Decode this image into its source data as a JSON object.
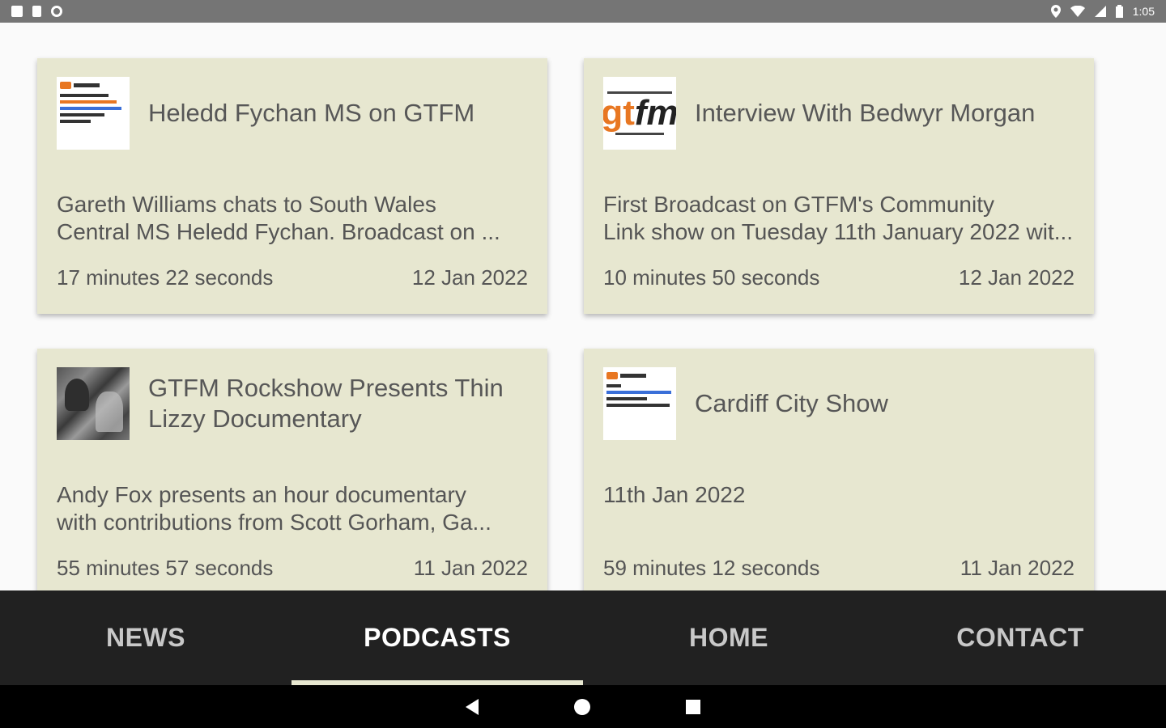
{
  "status_bar": {
    "time": "1:05",
    "left_icons": [
      "notification-square-icon",
      "sd-card-icon",
      "sync-circle-icon"
    ],
    "right_icons": [
      "location-icon",
      "wifi-icon",
      "cell-signal-icon",
      "battery-icon"
    ]
  },
  "podcasts": [
    {
      "title": "Heledd Fychan MS on GTFM",
      "description_line1": "Gareth Williams chats to South Wales",
      "description_line2": "Central MS Heledd Fychan. Broadcast on ...",
      "duration": "17 minutes 22 seconds",
      "date": "12 Jan 2022",
      "thumbnail": "podcast-text-thumbnail"
    },
    {
      "title": "Interview With Bedwyr Morgan",
      "description_line1": "First Broadcast on GTFM's Community",
      "description_line2": "Link show on Tuesday 11th January 2022 wit...",
      "duration": "10 minutes 50 seconds",
      "date": "12 Jan 2022",
      "thumbnail": "gtfm-logo-thumbnail",
      "logo_text_g": "gt",
      "logo_text_fm": "fm"
    },
    {
      "title": "GTFM Rockshow Presents Thin Lizzy Documentary",
      "description_line1": "Andy Fox presents an hour documentary",
      "description_line2": "with contributions from Scott Gorham, Ga...",
      "duration": "55 minutes 57 seconds",
      "date": "11 Jan 2022",
      "thumbnail": "band-photo-thumbnail"
    },
    {
      "title": "Cardiff City Show",
      "description_line1": "11th Jan 2022",
      "description_line2": "",
      "duration": "59 minutes 12 seconds",
      "date": "11 Jan 2022",
      "thumbnail": "podcast-text-thumbnail"
    }
  ],
  "tabs": [
    {
      "label": "NEWS",
      "active": false
    },
    {
      "label": "PODCASTS",
      "active": true
    },
    {
      "label": "HOME",
      "active": false
    },
    {
      "label": "CONTACT",
      "active": false
    }
  ],
  "colors": {
    "card_bg": "#e7e7d0",
    "tabbar_bg": "#212121",
    "status_bar_bg": "#757575",
    "accent_orange": "#e87722"
  }
}
